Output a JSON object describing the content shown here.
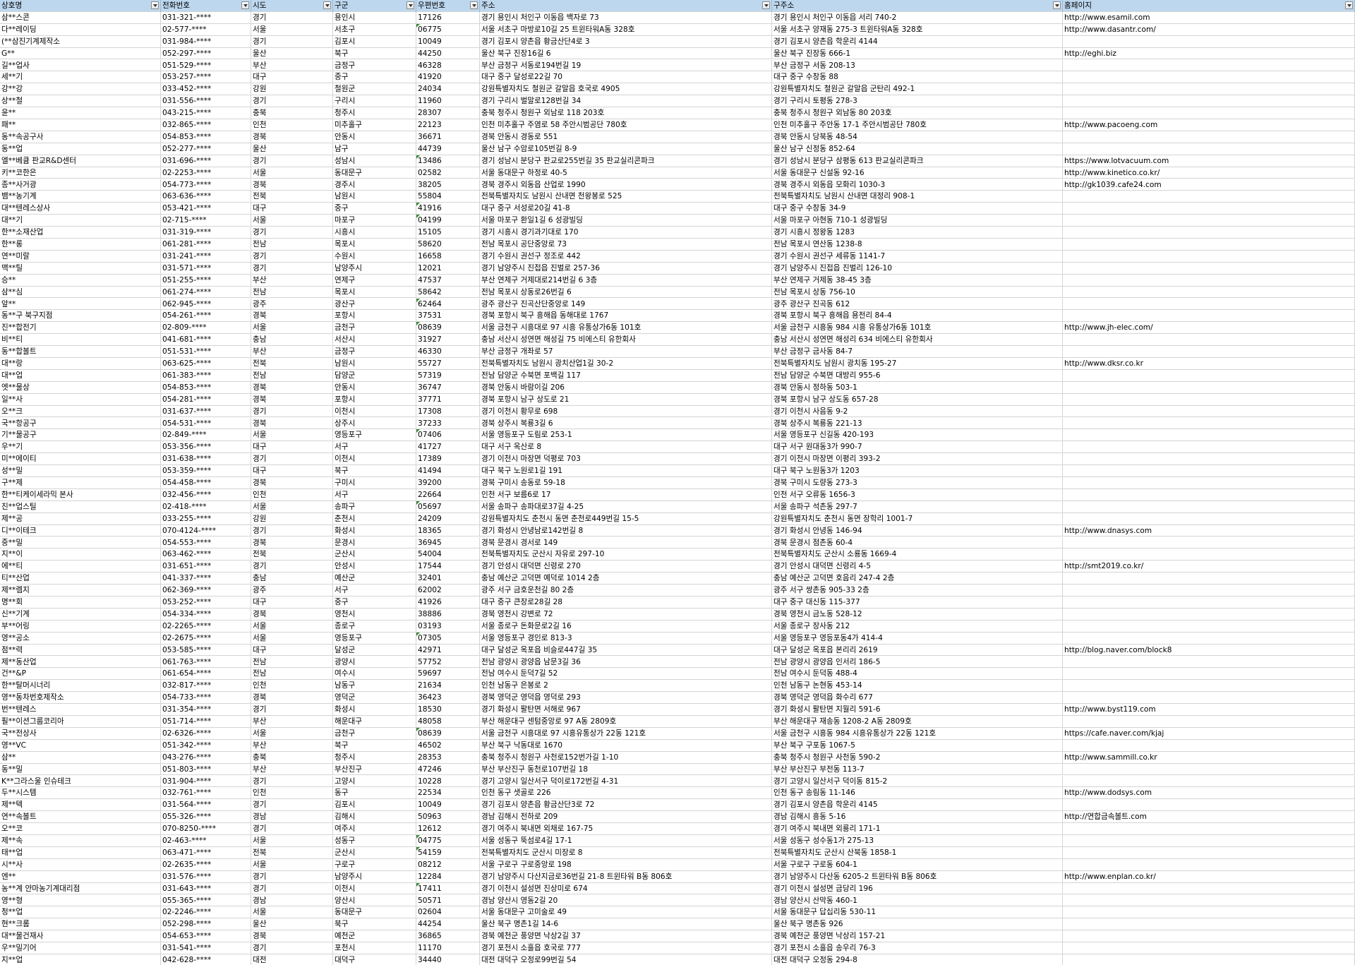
{
  "columns": [
    "상호명",
    "전화번호",
    "시도",
    "구군",
    "우편번호",
    "주소",
    "구주소",
    "홈페이지"
  ],
  "rows": [
    [
      "삼**스콘",
      "031-321-****",
      "경기",
      "용인시",
      "17126",
      "경기 용인시 처인구 이동읍 백자로 73",
      "경기 용인시 처인구 이동읍 서리 740-2",
      "http://www.esamil.com"
    ],
    [
      "다**레이딩",
      "02-577-****",
      "서울",
      "서초구",
      "06775",
      "서울 서초구 마방로10길 25 트윈타워A동 328호",
      "서울 서초구 양재동 275-3 트윈타워A동 328호",
      "http://www.dasantr.com/"
    ],
    [
      "(**삼진기계제작소",
      "031-984-****",
      "경기",
      "김포시",
      "10049",
      "경기 김포시 양촌읍 황금산단4로 3",
      "경기 김포시 양촌읍 학운리 4144",
      ""
    ],
    [
      "G**",
      "052-297-****",
      "울산",
      "북구",
      "44250",
      "울산 북구 진장16길 6",
      "울산 북구 진장동 666-1",
      "http://eghi.biz"
    ],
    [
      "길**업사",
      "051-529-****",
      "부산",
      "금정구",
      "46328",
      "부산 금정구 서동로194번길 19",
      "부산 금정구 서동 208-13",
      ""
    ],
    [
      "세**기",
      "053-257-****",
      "대구",
      "중구",
      "41920",
      "대구 중구 달성로22길 70",
      "대구 중구 수창동 88",
      ""
    ],
    [
      "강**강",
      "033-452-****",
      "강원",
      "철원군",
      "24034",
      "강원특별자치도 철원군 갈말읍 호국로 4905",
      "강원특별자치도 철원군 갈말읍 군탄리 492-1",
      ""
    ],
    [
      "상**철",
      "031-556-****",
      "경기",
      "구리시",
      "11960",
      "경기 구리시 벌말로128번길 34",
      "경기 구리시 토평동 278-3",
      ""
    ],
    [
      "윤**",
      "043-215-****",
      "충북",
      "청주시",
      "28307",
      "충북 청주시 청원구 외남로 118 203호",
      "충북 청주시 청원구 외남동 80 203호",
      ""
    ],
    [
      "패**",
      "032-865-****",
      "인천",
      "미추홀구",
      "22123",
      "인천 미추홀구 주염로 58 주안시범공단 780호",
      "인천 미추홀구 주안동 17-1 주안시범공단 780호",
      "http://www.pacoeng.com"
    ],
    [
      "동**속공구사",
      "054-853-****",
      "경북",
      "안동시",
      "36671",
      "경북 안동시 경동로 551",
      "경북 안동시 당북동 48-54",
      ""
    ],
    [
      "동**업",
      "052-277-****",
      "울산",
      "남구",
      "44739",
      "울산 남구 수암로105번길 8-9",
      "울산 남구 신정동 852-64",
      ""
    ],
    [
      "엘**베큠 판교R&D센터",
      "031-696-****",
      "경기",
      "성남시",
      "13486",
      "경기 성남시 분당구 판교로255번길 35 판교실리콘파크",
      "경기 성남시 분당구 삼평동 613 판교실리콘파크",
      "https://www.lotvacuum.com"
    ],
    [
      "키**코한은",
      "02-2253-****",
      "서울",
      "동대문구",
      "02582",
      "서울 동대문구 하정로 40-5",
      "서울 동대문구 신설동 92-16",
      "http://www.kinetico.co.kr/"
    ],
    [
      "종**사거광",
      "054-773-****",
      "경북",
      "경주시",
      "38205",
      "경북 경주시 외동읍 산업로 1990",
      "경북 경주시 외동읍 모화리 1030-3",
      "http://gk1039.cafe24.com"
    ],
    [
      "뱀**농기계",
      "063-636-****",
      "전북",
      "남원시",
      "55804",
      "전북특별자치도 남원시 산내면 천왕봉로 525",
      "전북특별자치도 남원시 산내면 대정리 908-1",
      ""
    ],
    [
      "대**텐레스상사",
      "053-421-****",
      "대구",
      "중구",
      "41916",
      "대구 중구 서성로20길 41-8",
      "대구 중구 수창동 34-9",
      ""
    ],
    [
      "대**기",
      "02-715-****",
      "서울",
      "마포구",
      "04199",
      "서울 마포구 환일1길 6 성광빌딩",
      "서울 마포구 아현동 710-1 성광빌딩",
      ""
    ],
    [
      "한**소재산업",
      "031-319-****",
      "경기",
      "시흥시",
      "15105",
      "경기 시흥시 경기과기대로 170",
      "경기 시흥시 정왕동 1283",
      ""
    ],
    [
      "한**롱",
      "061-281-****",
      "전남",
      "목포시",
      "58620",
      "전남 목포시 공단중앙로 73",
      "전남 목포시 연산동 1238-8",
      ""
    ],
    [
      "연**미랄",
      "031-241-****",
      "경기",
      "수원시",
      "16658",
      "경기 수원시 권선구 정조로 442",
      "경기 수원시 권선구 세류동 1141-7",
      ""
    ],
    [
      "맥**틸",
      "031-571-****",
      "경기",
      "남양주시",
      "12021",
      "경기 남양주시 진접읍 진벌로 257-36",
      "경기 남양주시 진접읍 진벌리 126-10",
      ""
    ],
    [
      "승**",
      "051-255-****",
      "부산",
      "연제구",
      "47537",
      "부산 연제구 거제대로214번길 6 3층",
      "부산 연제구 거제동 38-45 3층",
      ""
    ],
    [
      "삼**심",
      "061-274-****",
      "전남",
      "목포시",
      "58642",
      "전남 목포시 상동로26번길 6",
      "전남 목포시 상동 756-10",
      ""
    ],
    [
      "앞**",
      "062-945-****",
      "광주",
      "광산구",
      "62464",
      "광주 광산구 진곡산단중앙로 149",
      "광주 광산구 진곡동 612",
      ""
    ],
    [
      "동**구 북구지점",
      "054-261-****",
      "경북",
      "포항시",
      "37531",
      "경북 포항시 북구 흥해읍 동해대로 1767",
      "경북 포항시 북구 흥해읍 용전리 84-4",
      ""
    ],
    [
      "진**합전기",
      "02-809-****",
      "서울",
      "금천구",
      "08639",
      "서울 금천구 시흥대로 97 시흥 유통상가6동 101호",
      "서울 금천구 시흥동 984 시흥 유통상가6동 101호",
      "http://www.jh-elec.com/"
    ],
    [
      "비**티",
      "041-681-****",
      "충남",
      "서산시",
      "31927",
      "충남 서산시 성연면 해성길 75 비에스티 유한회사",
      "충남 서산시 성연면 해성리 634 비에스티 유한회사",
      ""
    ],
    [
      "동**합볼트",
      "051-531-****",
      "부산",
      "금정구",
      "46330",
      "부산 금정구 개좌로 57",
      "부산 금정구 금사동 84-7",
      ""
    ],
    [
      "대**랑",
      "063-625-****",
      "전북",
      "남원시",
      "55727",
      "전북특별자치도 남원시 광치산업1길 30-2",
      "전북특별자치도 남원시 광치동 195-27",
      "http://www.dksr.co.kr"
    ],
    [
      "대**업",
      "061-383-****",
      "전남",
      "담양군",
      "57319",
      "전남 담양군 수북면 포백길 117",
      "전남 담양군 수북면 대방리 955-6",
      ""
    ],
    [
      "엣**물상",
      "054-853-****",
      "경북",
      "안동시",
      "36747",
      "경북 안동시 바람이길 206",
      "경북 안동시 정하동 503-1",
      ""
    ],
    [
      "일**사",
      "054-281-****",
      "경북",
      "포항시",
      "37771",
      "경북 포항시 남구 상도로 21",
      "경북 포항시 남구 상도동 657-28",
      ""
    ],
    [
      "오**크",
      "031-637-****",
      "경기",
      "이천시",
      "17308",
      "경기 이천시 황무로 698",
      "경기 이천시 사음동 9-2",
      ""
    ],
    [
      "국**항공구",
      "054-531-****",
      "경북",
      "상주시",
      "37233",
      "경북 상주시 복룡3길 6",
      "경북 상주시 복룡동 221-13",
      ""
    ],
    [
      "기**물공구",
      "02-849-****",
      "서울",
      "영등포구",
      "07406",
      "서울 영등포구 도림로 253-1",
      "서울 영등포구 신길동 420-193",
      ""
    ],
    [
      "우**기",
      "053-356-****",
      "대구",
      "서구",
      "41727",
      "대구 서구 옥산로 8",
      "대구 서구 원대동3가 990-7",
      ""
    ],
    [
      "미**에이티",
      "031-638-****",
      "경기",
      "이천시",
      "17389",
      "경기 이천시 마장면 덕평로 703",
      "경기 이천시 마장면 이평리 393-2",
      ""
    ],
    [
      "성**밀",
      "053-359-****",
      "대구",
      "북구",
      "41494",
      "대구 북구 노원로1길 191",
      "대구 북구 노원동3가 1203",
      ""
    ],
    [
      "구**제",
      "054-458-****",
      "경북",
      "구미시",
      "39200",
      "경북 구미시 송동로 59-18",
      "경북 구미시 도량동 273-3",
      ""
    ],
    [
      "한**티케이세라믹 본사",
      "032-456-****",
      "인천",
      "서구",
      "22664",
      "인천 서구 보름6로 17",
      "인천 서구 오류동 1656-3",
      ""
    ],
    [
      "진**업스틸",
      "02-418-****",
      "서울",
      "송파구",
      "05697",
      "서울 송파구 송파대로37길 4-25",
      "서울 송파구 석촌동 297-7",
      ""
    ],
    [
      "제**공",
      "033-255-****",
      "강원",
      "춘천시",
      "24209",
      "강원특별자치도 춘천시 동면 춘천로449번길 15-5",
      "강원특별자치도 춘천시 동면 장학리 1001-7",
      ""
    ],
    [
      "디**이테크",
      "070-4124-****",
      "경기",
      "화성시",
      "18365",
      "경기 화성시 안녕남로142번길 8",
      "경기 화성시 안녕동 146-94",
      "http://www.dnasys.com"
    ],
    [
      "중**밀",
      "054-553-****",
      "경북",
      "문경시",
      "36945",
      "경북 문경시 경서로 149",
      "경북 문경시 점촌동 60-4",
      ""
    ],
    [
      "지**이",
      "063-462-****",
      "전북",
      "군산시",
      "54004",
      "전북특별자치도 군산시 자유로 297-10",
      "전북특별자치도 군산시 소룡동 1669-4",
      ""
    ],
    [
      "에**티",
      "031-651-****",
      "경기",
      "안성시",
      "17544",
      "경기 안성시 대덕면 신령로 270",
      "경기 안성시 대덕면 신령리 4-5",
      "http://smt2019.co.kr/"
    ],
    [
      "티**산업",
      "041-337-****",
      "충남",
      "예산군",
      "32401",
      "충남 예산군 고덕면 예덕로 1014 2층",
      "충남 예산군 고덕면 호음리 247-4 2층",
      ""
    ],
    [
      "제**렘지",
      "062-369-****",
      "광주",
      "서구",
      "62002",
      "광주 서구 금호운천길 80 2층",
      "광주 서구 쌍촌동 905-33 2층",
      ""
    ],
    [
      "명**회",
      "053-252-****",
      "대구",
      "중구",
      "41926",
      "대구 중구 큰장로28길 28",
      "대구 중구 대신동 115-377",
      ""
    ],
    [
      "신**기계",
      "054-334-****",
      "경북",
      "영천시",
      "38886",
      "경북 영천시 강변로 72",
      "경북 영천시 금노동 528-12",
      ""
    ],
    [
      "부**어링",
      "02-2265-****",
      "서울",
      "종로구",
      "03193",
      "서울 종로구 돈화문로2길 16",
      "서울 종로구 장사동 212",
      ""
    ],
    [
      "영**공소",
      "02-2675-****",
      "서울",
      "영등포구",
      "07305",
      "서울 영등포구 경인로 813-3",
      "서울 영등포구 영등포동4가 414-4",
      ""
    ],
    [
      "점**력",
      "053-585-****",
      "대구",
      "달성군",
      "42971",
      "대구 달성군 옥포읍 비슬로447길 35",
      "대구 달성군 옥포읍 본리리 2619",
      "http://blog.naver.com/block8"
    ],
    [
      "제**동산업",
      "061-763-****",
      "전남",
      "광양시",
      "57752",
      "전남 광양시 광양읍 남문3길 36",
      "전남 광양시 광양읍 인서리 186-5",
      ""
    ],
    [
      "건**&P",
      "061-654-****",
      "전남",
      "여수시",
      "59697",
      "전남 여수시 둔덕7길 52",
      "전남 여수시 둔덕동 488-4",
      ""
    ],
    [
      "한**탈머시너리",
      "032-817-****",
      "인천",
      "남동구",
      "21634",
      "인천 남동구 은봉로 2",
      "인천 남동구 논현동 453-14",
      ""
    ],
    [
      "영**동차번호제작소",
      "054-733-****",
      "경북",
      "영덕군",
      "36423",
      "경북 영덕군 영덕읍 영덕로 293",
      "경북 영덕군 영덕읍 화수리 677",
      ""
    ],
    [
      "번**텐레스",
      "031-354-****",
      "경기",
      "화성시",
      "18530",
      "경기 화성시 팔탄면 서해로 967",
      "경기 화성시 팔탄면 지월리 591-6",
      "http://www.byst119.com"
    ],
    [
      "필**이션그룹코리아",
      "051-714-****",
      "부산",
      "해운대구",
      "48058",
      "부산 해운대구 센텀중앙로 97 A동 2809호",
      "부산 해운대구 재송동 1208-2 A동 2809호",
      ""
    ],
    [
      "국**전상사",
      "02-6326-****",
      "서울",
      "금천구",
      "08639",
      "서울 금천구 시흥대로 97 시흥유통상가 22동 121호",
      "서울 금천구 시흥동 984 시흥유통상가 22동 121호",
      "https://cafe.naver.com/kjaj"
    ],
    [
      "영**VC",
      "051-342-****",
      "부산",
      "북구",
      "46502",
      "부산 북구 낙동대로 1670",
      "부산 북구 구포동 1067-5",
      ""
    ],
    [
      "삼**",
      "043-276-****",
      "충북",
      "청주시",
      "28353",
      "충북 청주시 청원구 사천로152번가길 1-10",
      "충북 청주시 청원구 사천동 590-2",
      "http://www.sammill.co.kr"
    ],
    [
      "동**밀",
      "051-803-****",
      "부산",
      "부산진구",
      "47246",
      "부산 부산진구 동천로107번길 18",
      "부산 부산진구 부전동 113-7",
      ""
    ],
    [
      "K**그라스울 인슈테크",
      "031-904-****",
      "경기",
      "고양시",
      "10228",
      "경기 고양시 일산서구 덕이로172번길 4-31",
      "경기 고양시 일산서구 덕이동 815-2",
      ""
    ],
    [
      "두**시스템",
      "032-761-****",
      "인천",
      "동구",
      "22534",
      "인천 동구 샛골로 226",
      "인천 동구 송림동 11-146",
      "http://www.dodsys.com"
    ],
    [
      "제**텍",
      "031-564-****",
      "경기",
      "김포시",
      "10049",
      "경기 김포시 양촌읍 황금산단3로 72",
      "경기 김포시 양촌읍 학운리 4145",
      ""
    ],
    [
      "연**속볼트",
      "055-326-****",
      "경남",
      "김해시",
      "50963",
      "경남 김해시 전하로 209",
      "경남 김해시 흥동 5-16",
      "http://연합금속볼트.com"
    ],
    [
      "오**코",
      "070-8250-****",
      "경기",
      "여주시",
      "12612",
      "경기 여주시 북내면 외채로 167-75",
      "경기 여주시 북내면 외룡리 171-1",
      ""
    ],
    [
      "제**속",
      "02-463-****",
      "서울",
      "성동구",
      "04775",
      "서울 성동구 뚝섬로4길 17-1",
      "서울 성동구 성수동1가 275-13",
      ""
    ],
    [
      "태**업",
      "063-471-****",
      "전북",
      "군산시",
      "54159",
      "전북특별자치도 군산시 미장로 8",
      "전북특별자치도 군산시 산북동 1858-1",
      ""
    ],
    [
      "시**사",
      "02-2635-****",
      "서울",
      "구로구",
      "08212",
      "서울 구로구 구로중앙로 198",
      "서울 구로구 구로동 604-1",
      ""
    ],
    [
      "엔**",
      "031-576-****",
      "경기",
      "남양주시",
      "12284",
      "경기 남양주시 다산지금로36번길 21-8 트윈타워 B동 806호",
      "경기 남양주시 다산동 6205-2 트윈타워 B동 806호",
      "http://www.enplan.co.kr/"
    ],
    [
      "농**계 얀마농기계대리점",
      "031-643-****",
      "경기",
      "이천시",
      "17411",
      "경기 이천시 설성면 진상미로 674",
      "경기 이천시 설성면 금당리 196",
      ""
    ],
    [
      "영**형",
      "055-365-****",
      "경남",
      "양산시",
      "50571",
      "경남 양산시 영동2길 20",
      "경남 양산시 산막동 460-1",
      ""
    ],
    [
      "청**업",
      "02-2246-****",
      "서울",
      "동대문구",
      "02604",
      "서울 동대문구 고미술로 49",
      "서울 동대문구 답십리동 530-11",
      ""
    ],
    [
      "현**크롬",
      "052-298-****",
      "울산",
      "북구",
      "44254",
      "울산 북구 명촌1길 14-6",
      "울산 북구 명촌동 926",
      ""
    ],
    [
      "대**물건재사",
      "054-653-****",
      "경북",
      "예천군",
      "36865",
      "경북 예천군 풍양면 낙상2길 37",
      "경북 예천군 풍양면 낙상리 157-21",
      ""
    ],
    [
      "우**밀기어",
      "031-541-****",
      "경기",
      "포천시",
      "11170",
      "경기 포천시 소흘읍 호국로 777",
      "경기 포천시 소흘읍 송우리 76-3",
      ""
    ],
    [
      "지**업",
      "042-628-****",
      "대전",
      "대덕구",
      "34440",
      "대전 대덕구 오정로99번길 54",
      "대전 대덕구 오정동 294-8",
      ""
    ]
  ],
  "green_marker_rows": [
    1,
    12,
    16,
    17,
    24,
    26,
    35,
    41,
    52,
    60,
    69,
    70,
    73
  ]
}
